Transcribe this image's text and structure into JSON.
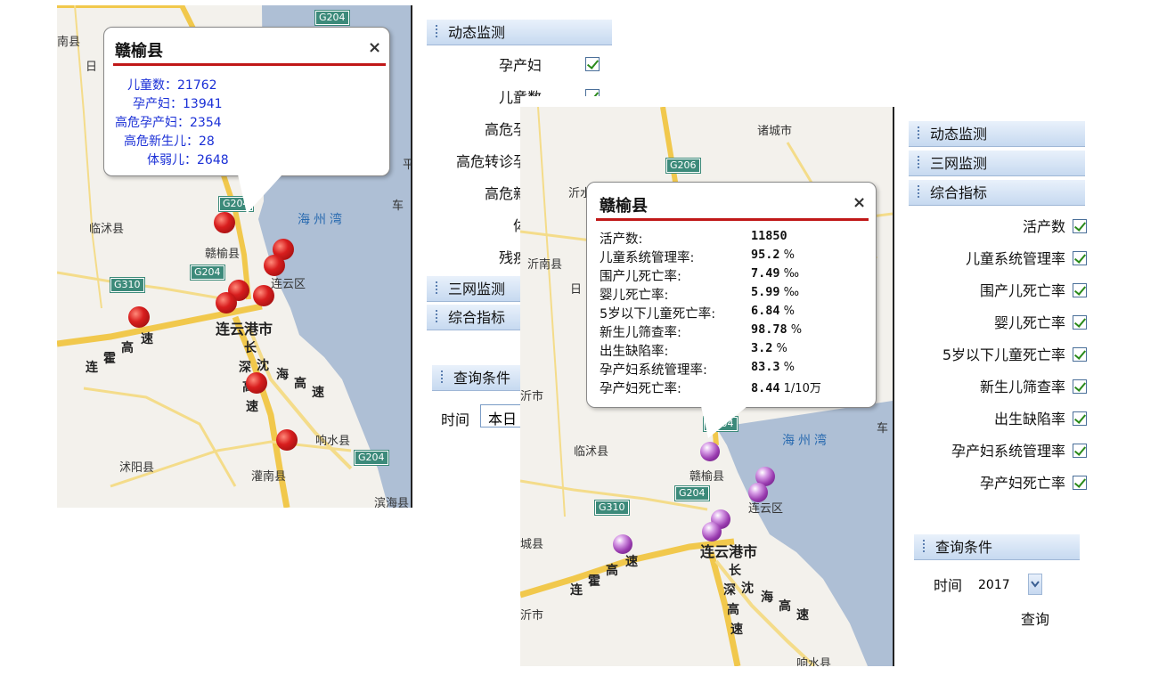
{
  "left": {
    "map": {
      "labels": {
        "nanxian": "南县",
        "ri": "日",
        "ganyu": "赣榆县",
        "linshu": "临沭县",
        "haizhou_bay": "海州湾",
        "lianyun": "连云区",
        "city": "连云港市",
        "shuyang": "沭阳县",
        "xiangshui": "响水县",
        "guanan": "灌南县",
        "binhai": "滨海县",
        "ping": "平",
        "che": "车",
        "ganyu_county": "赣榆县",
        "xin": "新"
      },
      "shields": {
        "g204_top": "G204",
        "g204_a": "G204",
        "g204_b": "G204",
        "g310": "G310",
        "g204_c": "G204"
      },
      "highway_chars": [
        "连",
        "霍",
        "高",
        "速",
        "长",
        "深",
        "高",
        "速",
        "沈",
        "海",
        "高",
        "速"
      ]
    },
    "popup": {
      "title": "赣榆县",
      "close": "×",
      "rows": [
        "儿童数：21762",
        "孕产妇：13941",
        "高危孕产妇：2354",
        "高危新生儿：28",
        "体弱儿：2648"
      ]
    },
    "panel": {
      "header_dynamic": "动态监测",
      "items": [
        "孕产妇",
        "儿童数",
        "高危孕产",
        "高危转诊孕产",
        "高危新生",
        "体弱",
        "残疾儿"
      ],
      "header_three_net": "三网监测",
      "header_comprehensive": "综合指标",
      "header_query": "查询条件",
      "time_label": "时间",
      "time_value": "本日"
    }
  },
  "right": {
    "map": {
      "labels": {
        "zhucheng": "诸城市",
        "yishui": "沂水",
        "yinan": "沂南县",
        "ri": "日",
        "linshu": "临沭县",
        "ganyu": "赣榆县",
        "haizhou_bay": "海州湾",
        "lianyun": "连云区",
        "city": "连云港市",
        "xinshi": "沂市",
        "cheng": "城县",
        "che": "车",
        "xiangshui": "响水县",
        "xinshi2": "沂市"
      },
      "shields": {
        "g206": "G206",
        "g204_a": "G204",
        "g204_b": "G204",
        "g310": "G310"
      }
    },
    "popup": {
      "title": "赣榆县",
      "close": "×",
      "rows": [
        {
          "label": "活产数:",
          "value": "11850",
          "unit": ""
        },
        {
          "label": "儿童系统管理率:",
          "value": "95.2",
          "unit": " %"
        },
        {
          "label": "围产儿死亡率:",
          "value": "7.49",
          "unit": " ‰"
        },
        {
          "label": "婴儿死亡率:",
          "value": "5.99",
          "unit": " ‰"
        },
        {
          "label": "5岁以下儿童死亡率:",
          "value": "6.84",
          "unit": " %"
        },
        {
          "label": "新生儿筛查率:",
          "value": "98.78",
          "unit": " %"
        },
        {
          "label": "出生缺陷率:",
          "value": "3.2",
          "unit": " %"
        },
        {
          "label": "孕产妇系统管理率:",
          "value": "83.3",
          "unit": " %"
        },
        {
          "label": "孕产妇死亡率:",
          "value": "8.44",
          "unit": " 1/10万"
        }
      ]
    },
    "panel": {
      "header_dynamic": "动态监测",
      "header_three_net": "三网监测",
      "header_comprehensive": "综合指标",
      "items": [
        "活产数",
        "儿童系统管理率",
        "围产儿死亡率",
        "婴儿死亡率",
        "5岁以下儿童死亡率",
        "新生儿筛查率",
        "出生缺陷率",
        "孕产妇系统管理率",
        "孕产妇死亡率"
      ],
      "header_query": "查询条件",
      "time_label": "时间",
      "time_value": "2017",
      "query_button": "查询"
    }
  }
}
